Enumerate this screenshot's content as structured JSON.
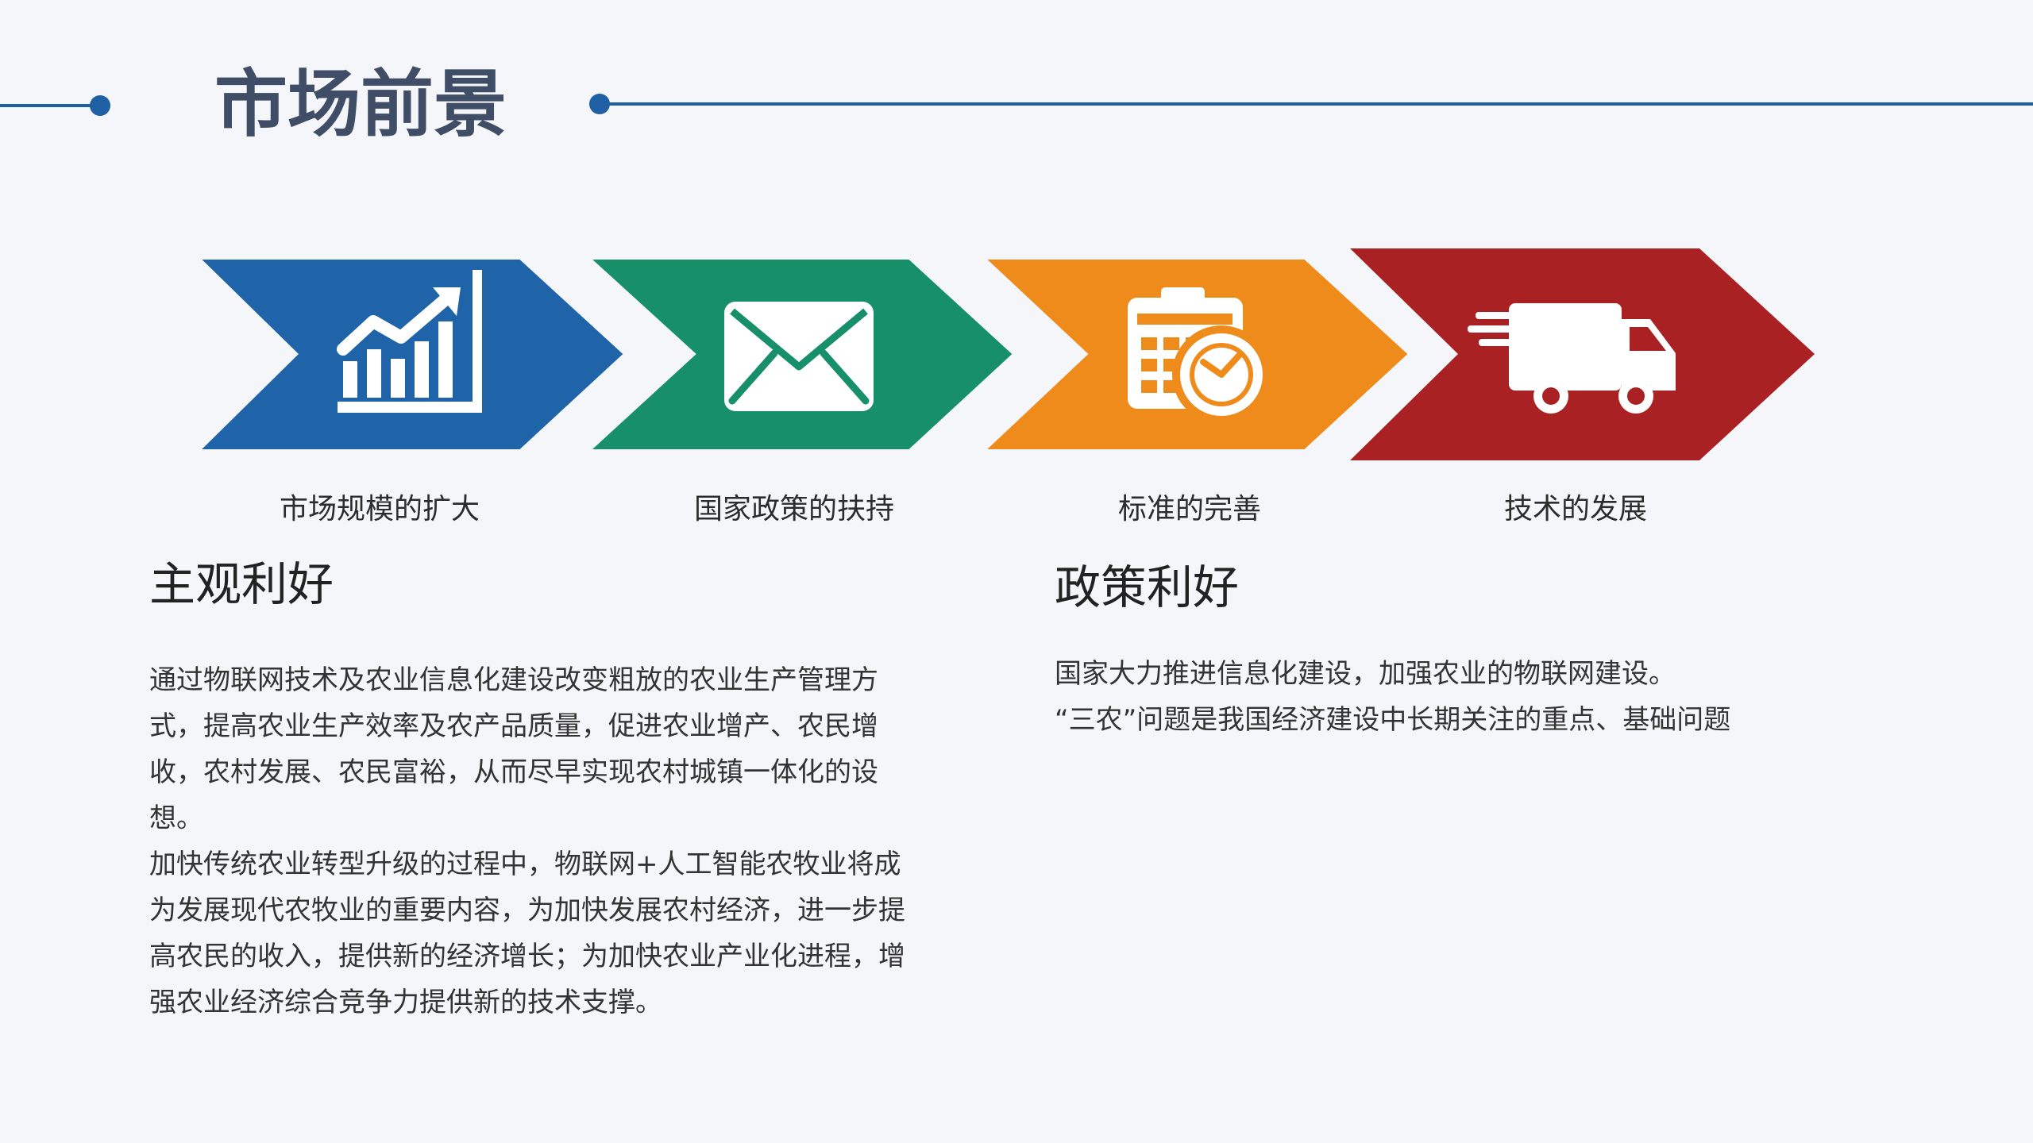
{
  "header": {
    "title": "市场前景"
  },
  "colors": {
    "accent_line": "#1f5fa3",
    "chevron_blue": "#1f64a8",
    "chevron_green": "#17906a",
    "chevron_orange": "#ee8b1a",
    "chevron_red": "#aa2124"
  },
  "steps": [
    {
      "icon": "bar-chart-growth-icon",
      "label": "市场规模的扩大"
    },
    {
      "icon": "envelope-icon",
      "label": "国家政策的扶持"
    },
    {
      "icon": "calendar-clock-icon",
      "label": "标准的完善"
    },
    {
      "icon": "delivery-truck-icon",
      "label": "技术的发展"
    }
  ],
  "left_section": {
    "heading": "主观利好",
    "paragraphs": [
      "通过物联网技术及农业信息化建设改变粗放的农业生产管理方式，提高农业生产效率及农产品质量，促进农业增产、农民增收，农村发展、农民富裕，从而尽早实现农村城镇一体化的设想。",
      "加快传统农业转型升级的过程中，物联网+人工智能农牧业将成为发展现代农牧业的重要内容，为加快发展农村经济，进一步提高农民的收入，提供新的经济增长；为加快农业产业化进程，增强农业经济综合竞争力提供新的技术支撑。"
    ]
  },
  "right_section": {
    "heading": "政策利好",
    "paragraphs": [
      "国家大力推进信息化建设，加强农业的物联网建设。",
      "“三农”问题是我国经济建设中长期关注的重点、基础问题"
    ]
  }
}
